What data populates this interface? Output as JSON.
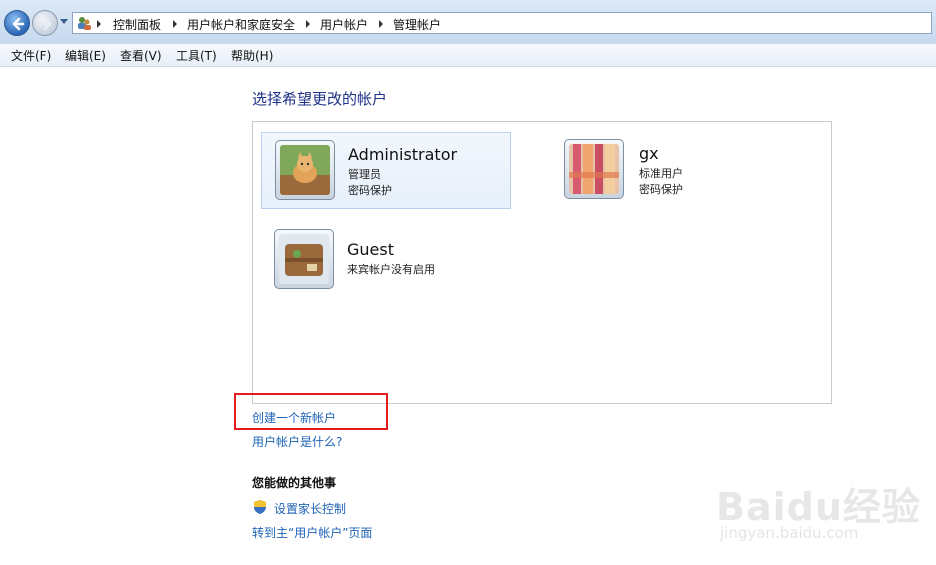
{
  "breadcrumb": [
    "控制面板",
    "用户帐户和家庭安全",
    "用户帐户",
    "管理帐户"
  ],
  "menu": [
    "文件(F)",
    "编辑(E)",
    "查看(V)",
    "工具(T)",
    "帮助(H)"
  ],
  "page_title": "选择希望更改的帐户",
  "accounts": [
    {
      "name": "Administrator",
      "lines": [
        "管理员",
        "密码保护"
      ],
      "selected": true,
      "picture": "kitten-picture"
    },
    {
      "name": "gx",
      "lines": [
        "标准用户",
        "密码保护"
      ],
      "selected": false,
      "picture": "fabric-picture"
    },
    {
      "name": "Guest",
      "lines": [
        "来宾帐户没有启用"
      ],
      "selected": false,
      "picture": "suitcase-picture"
    }
  ],
  "links": {
    "create_account": "创建一个新帐户",
    "what_is_account": "用户帐户是什么?"
  },
  "other_tasks": {
    "heading": "您能做的其他事",
    "parental_controls": "设置家长控制",
    "goto_main": "转到主“用户帐户”页面"
  },
  "watermark": {
    "brand": "Baidu经验",
    "url": "jingyan.baidu.com"
  },
  "colors": {
    "link": "#1e63b6",
    "title": "#1e3287",
    "highlight_box": "#e41c1c"
  }
}
